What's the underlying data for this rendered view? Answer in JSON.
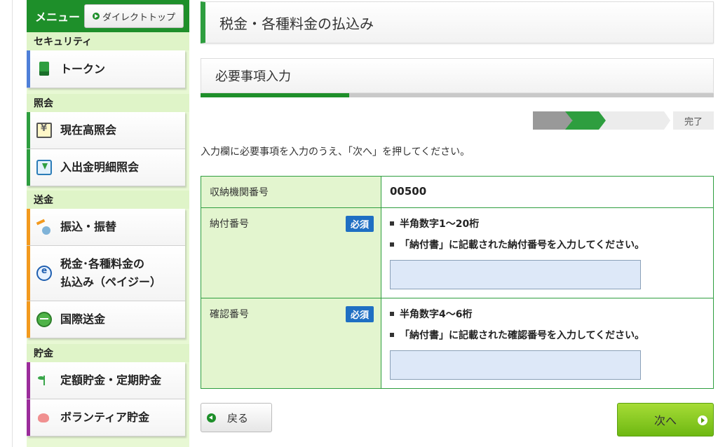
{
  "sidebar": {
    "menu_title": "メニュー",
    "direct_top_label": "ダイレクトトップ",
    "sections": {
      "security": "セキュリティ",
      "inquiry": "照会",
      "remittance": "送金",
      "savings": "貯金"
    },
    "items": {
      "token": "トークン",
      "balance": "現在高照会",
      "detail": "入出金明細照会",
      "transfer": "振込・振替",
      "payeasy_line1": "税金･各種料金の",
      "payeasy_line2": "払込み（ペイジー）",
      "international": "国際送金",
      "fixed_savings": "定額貯金・定期貯金",
      "volunteer": "ボランティア貯金"
    },
    "accents": {
      "security": "#4f7fd8",
      "inquiry": "#2e9e3f",
      "remittance": "#f39a1e",
      "savings": "#9b2c9b"
    }
  },
  "main": {
    "page_title": "税金・各種料金の払込み",
    "step_title": "必要事項入力",
    "progress_fraction": 0.29,
    "steps": {
      "done_label": "完了"
    },
    "instruction": "入力欄に必要事項を入力のうえ、「次へ」を押してください。",
    "rows": {
      "institution": {
        "label": "収納機関番号",
        "value": "00500"
      },
      "payment_number": {
        "label": "納付番号",
        "required": "必須",
        "rule1": "半角数字1～20桁",
        "rule2": "「納付書」に記載された納付番号を入力してください。",
        "value": ""
      },
      "confirmation_number": {
        "label": "確認番号",
        "required": "必須",
        "rule1": "半角数字4～6桁",
        "rule2": "「納付書」に記載された確認番号を入力してください。",
        "value": ""
      }
    },
    "buttons": {
      "back": "戻る",
      "next": "次へ"
    }
  }
}
